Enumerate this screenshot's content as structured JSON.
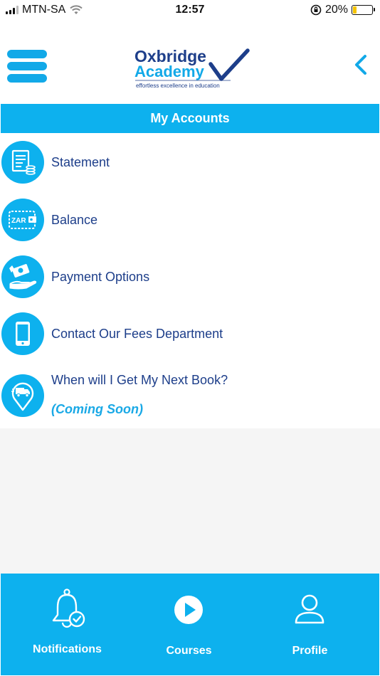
{
  "status_bar": {
    "carrier": "MTN-SA",
    "time": "12:57",
    "battery_percent": "20%",
    "battery_level": 0.2
  },
  "header": {
    "logo": {
      "line1": "Oxbridge",
      "line2": "Academy",
      "tagline": "effortless excellence in education"
    },
    "menu_icon": "hamburger-menu-icon",
    "back_icon": "chevron-left-icon"
  },
  "section": {
    "title": "My Accounts"
  },
  "menu_items": [
    {
      "label": "Statement",
      "icon": "statement-document-icon"
    },
    {
      "label": "Balance",
      "icon": "wallet-zar-icon",
      "icon_text": "ZAR"
    },
    {
      "label": "Payment Options",
      "icon": "payment-hand-icon"
    },
    {
      "label": "Contact Our Fees Department",
      "icon": "mobile-phone-icon"
    },
    {
      "label": "When will I Get My Next Book?",
      "sublabel": "(Coming Soon)",
      "icon": "delivery-truck-pin-icon"
    }
  ],
  "tabs": [
    {
      "label": "Notifications",
      "icon": "bell-check-icon"
    },
    {
      "label": "Courses",
      "icon": "play-circle-icon"
    },
    {
      "label": "Profile",
      "icon": "user-icon"
    }
  ],
  "colors": {
    "accent": "#0db1ee",
    "navy": "#1d3e8a",
    "coming_soon": "#1aa9e6"
  }
}
